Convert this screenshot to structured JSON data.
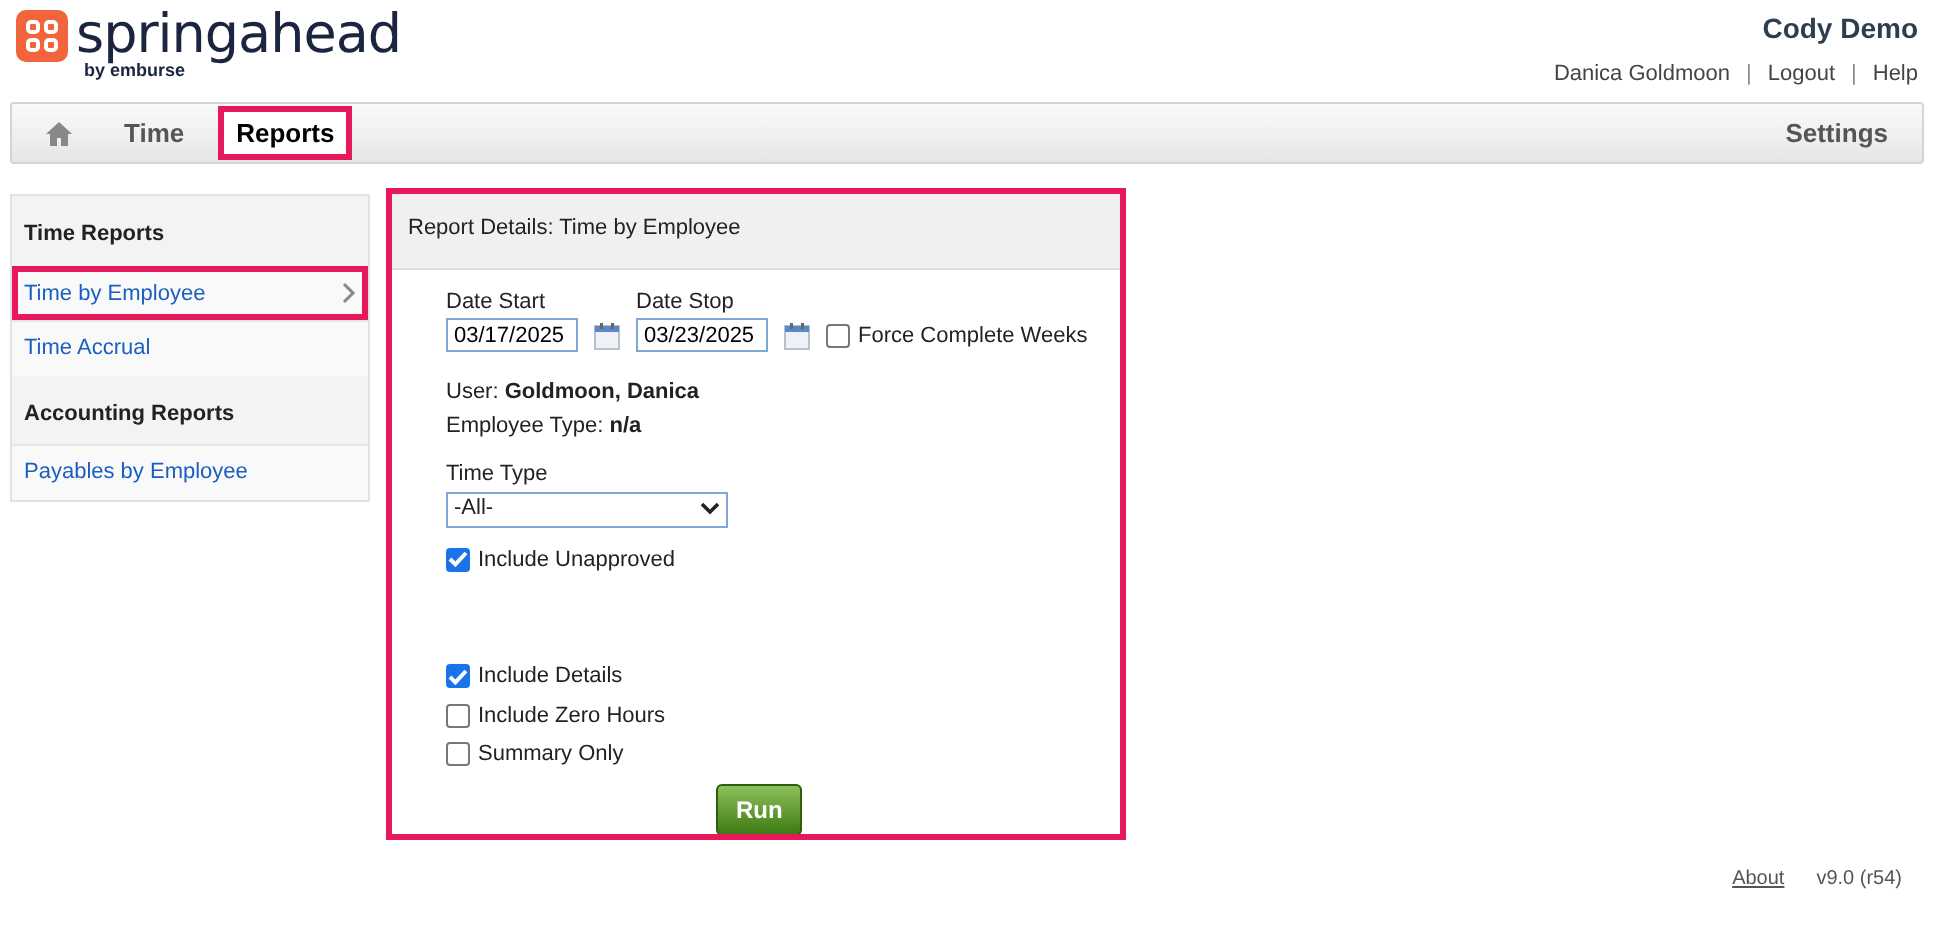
{
  "header": {
    "logo_text": "springahead",
    "logo_subtext": "by emburse",
    "company": "Cody Demo",
    "user_links": [
      {
        "kind": "link",
        "label": "Danica Goldmoon"
      },
      {
        "kind": "separator",
        "label": "|"
      },
      {
        "kind": "link",
        "label": "Logout"
      },
      {
        "kind": "separator",
        "label": "|"
      },
      {
        "kind": "link",
        "label": "Help"
      }
    ]
  },
  "nav": {
    "tabs": [
      {
        "kind": "home",
        "selected": false,
        "highlighted": false
      },
      {
        "kind": "text",
        "label": "Time",
        "selected": false,
        "highlighted": false
      },
      {
        "kind": "text",
        "label": "Reports",
        "selected": true,
        "highlighted": true
      }
    ],
    "right_tab": "Settings"
  },
  "sidebar": {
    "sections": [
      {
        "heading": "Time Reports",
        "items": [
          {
            "label": "Time by Employee",
            "selected": true,
            "highlighted": true
          },
          {
            "label": "Time Accrual",
            "selected": false,
            "highlighted": false
          }
        ]
      },
      {
        "heading": "Accounting Reports",
        "items": [
          {
            "label": "Payables by Employee",
            "selected": false,
            "highlighted": false
          }
        ]
      }
    ]
  },
  "panel": {
    "title": "Report Details: Time by Employee",
    "highlighted": true,
    "date_start": {
      "label": "Date Start",
      "value": "03/17/2025"
    },
    "date_stop": {
      "label": "Date Stop",
      "value": "03/23/2025"
    },
    "force_complete_weeks": {
      "label": "Force Complete Weeks",
      "checked": false
    },
    "user": {
      "label": "User:",
      "value": "Goldmoon, Danica"
    },
    "employee_type": {
      "label": "Employee Type:",
      "value": "n/a"
    },
    "time_type": {
      "label": "Time Type",
      "value": "-All-"
    },
    "include_unapproved": {
      "label": "Include Unapproved",
      "checked": true
    },
    "options": [
      {
        "label": "Include Details",
        "checked": true
      },
      {
        "label": "Include Zero Hours",
        "checked": false
      },
      {
        "label": "Summary Only",
        "checked": false
      }
    ],
    "run_button": "Run"
  },
  "footer": {
    "about": "About",
    "version": "v9.0 (r54)"
  }
}
